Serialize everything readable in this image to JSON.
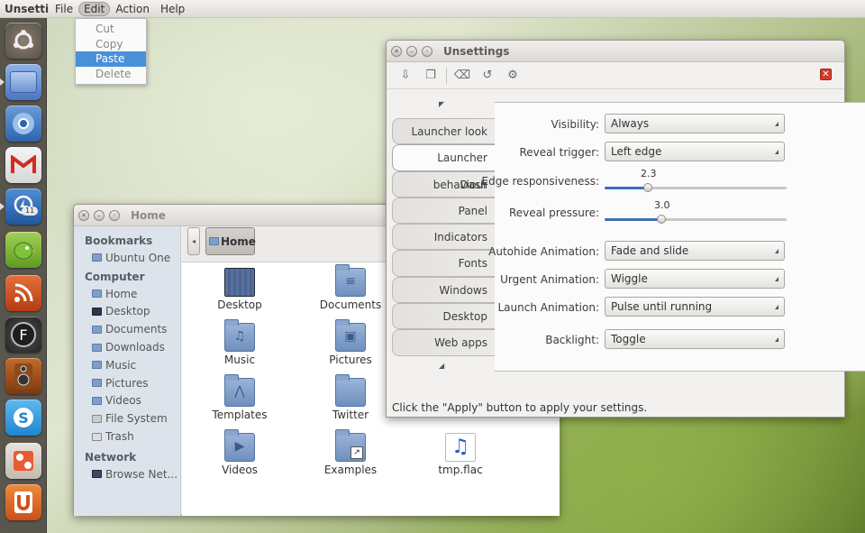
{
  "topbar": {
    "app_name": "Unsettings",
    "menus": [
      "File",
      "Edit",
      "Action",
      "Help"
    ]
  },
  "edit_menu": {
    "items": [
      "Cut",
      "Copy",
      "Paste",
      "Delete"
    ],
    "selected": "Paste"
  },
  "launcher": {
    "badge": "11",
    "icons": [
      "ubuntu",
      "files",
      "chromium",
      "gmail",
      "thunderbolt",
      "gwibber",
      "rss",
      "f-spot",
      "speaker",
      "skype",
      "settings",
      "ubuntu-one"
    ]
  },
  "home": {
    "title": "Home",
    "crumb": "Home",
    "sidebar": {
      "bookmarks_head": "Bookmarks",
      "bookmarks": [
        "Ubuntu One"
      ],
      "computer_head": "Computer",
      "computer": [
        "Home",
        "Desktop",
        "Documents",
        "Downloads",
        "Music",
        "Pictures",
        "Videos",
        "File System",
        "Trash"
      ],
      "network_head": "Network",
      "network": [
        "Browse Net..."
      ]
    },
    "files": [
      "Desktop",
      "Documents",
      "Music",
      "Pictures",
      "Templates",
      "Twitter",
      "Videos",
      "Examples",
      "tmp.flac"
    ]
  },
  "unsettings": {
    "title": "Unsettings",
    "tabs": [
      "Launcher look",
      "Launcher behaviour",
      "Dash",
      "Panel",
      "Indicators",
      "Fonts",
      "Windows",
      "Desktop",
      "Web apps"
    ],
    "active_tab": "Launcher behaviour",
    "visibility": {
      "label": "Visibility:",
      "value": "Always"
    },
    "reveal_trigger": {
      "label": "Reveal trigger:",
      "value": "Left edge"
    },
    "edge_responsiveness": {
      "label": "Edge responsiveness:",
      "value": "2.3",
      "fraction": 0.24
    },
    "reveal_pressure": {
      "label": "Reveal pressure:",
      "value": "3.0",
      "fraction": 0.31
    },
    "autohide_animation": {
      "label": "Autohide Animation:",
      "value": "Fade and slide"
    },
    "urgent_animation": {
      "label": "Urgent Animation:",
      "value": "Wiggle"
    },
    "launch_animation": {
      "label": "Launch Animation:",
      "value": "Pulse until running"
    },
    "backlight": {
      "label": "Backlight:",
      "value": "Toggle"
    },
    "hint": "Click the \"Apply\" button to apply your settings."
  }
}
